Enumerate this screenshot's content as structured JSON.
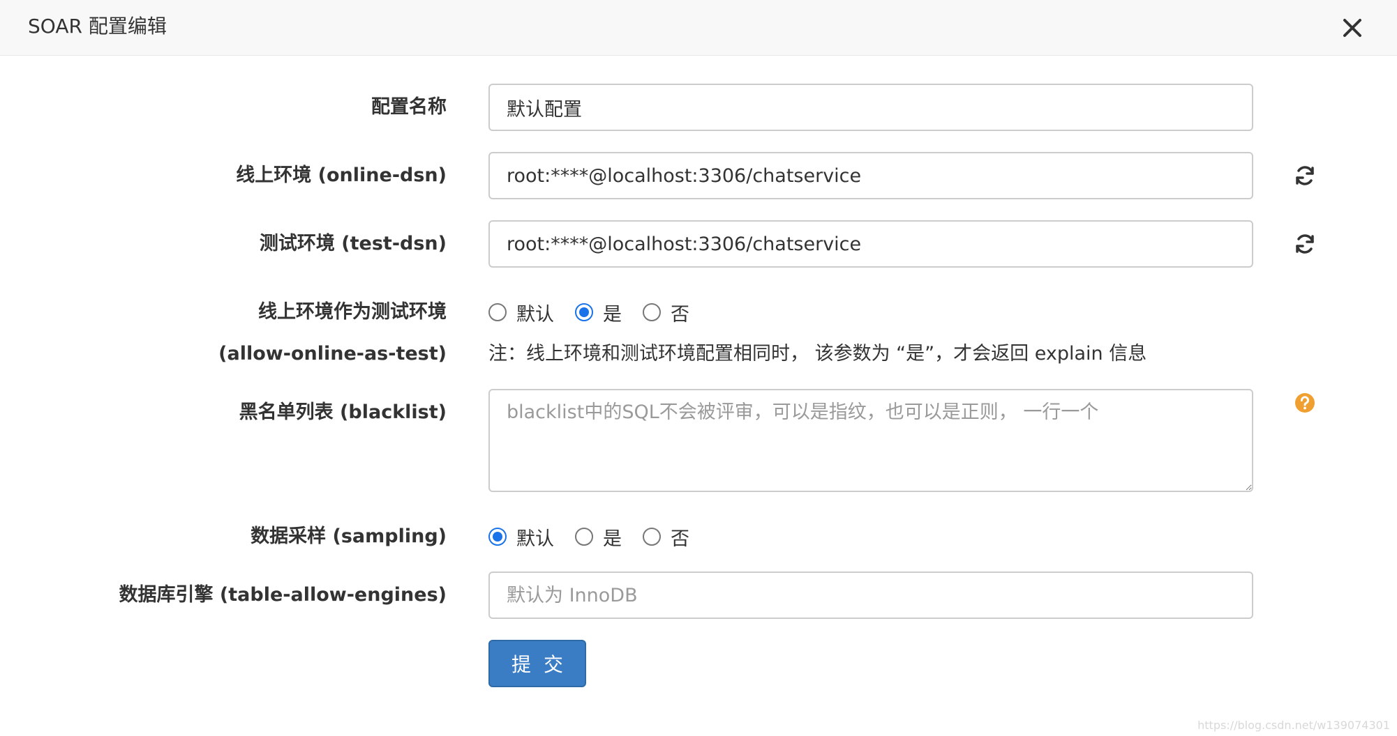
{
  "dialog": {
    "title": "SOAR 配置编辑",
    "close_label": "×"
  },
  "form": {
    "config_name": {
      "label": "配置名称",
      "value": "默认配置"
    },
    "online_dsn": {
      "label": "线上环境 (online-dsn)",
      "value": "root:****@localhost:3306/chatservice",
      "action_icon": "refresh-icon"
    },
    "test_dsn": {
      "label": "测试环境 (test-dsn)",
      "value": "root:****@localhost:3306/chatservice",
      "action_icon": "refresh-icon"
    },
    "allow_online_as_test": {
      "label_line1": "线上环境作为测试环境",
      "label_line2": "(allow-online-as-test)",
      "options": [
        "默认",
        "是",
        "否"
      ],
      "selected": "是",
      "note": "注：线上环境和测试环境配置相同时， 该参数为 “是”，才会返回 explain 信息"
    },
    "blacklist": {
      "label": "黑名单列表 (blacklist)",
      "value": "",
      "placeholder": "blacklist中的SQL不会被评审，可以是指纹，也可以是正则， 一行一个",
      "help_icon": "question-circle-icon"
    },
    "sampling": {
      "label": "数据采样 (sampling)",
      "options": [
        "默认",
        "是",
        "否"
      ],
      "selected": "默认"
    },
    "table_allow_engines": {
      "label": "数据库引擎 (table-allow-engines)",
      "value": "",
      "placeholder": "默认为 InnoDB"
    },
    "submit_label": "提交"
  },
  "watermark": "https://blog.csdn.net/w139074301",
  "colors": {
    "primary_button": "#3b7dc4",
    "radio_checked": "#1a73e8",
    "help_icon": "#f0a030",
    "header_bg": "#f8f8f8"
  }
}
